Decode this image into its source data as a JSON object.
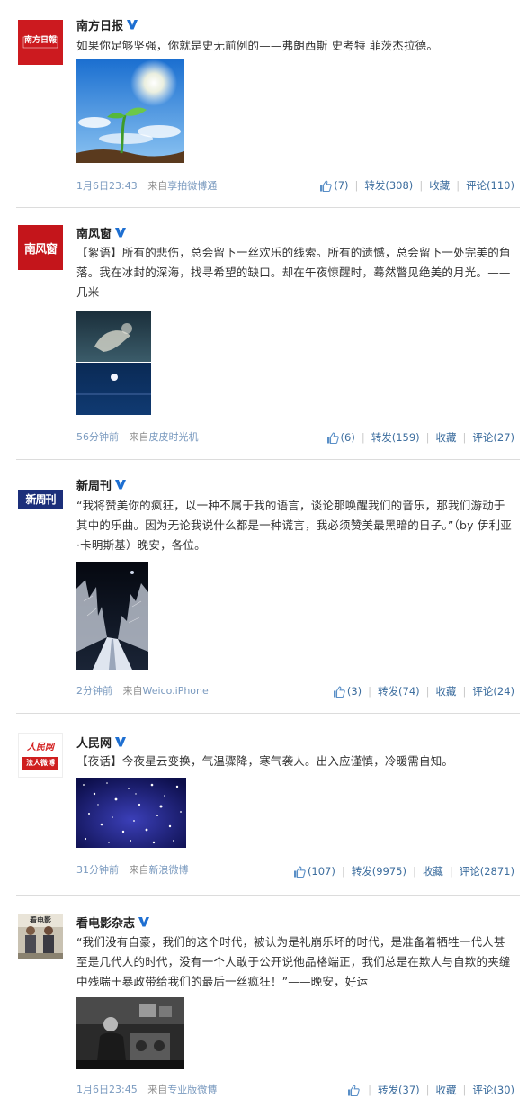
{
  "posts": [
    {
      "author": "南方日报",
      "avatar_text": "南方日報",
      "text": "如果你足够坚强，你就是史无前例的——弗朗西斯 史考特 菲茨杰拉德。",
      "time": "1月6日23:43",
      "source_prefix": "来自",
      "source": "享拍微博通",
      "like": "(7)",
      "forward": "转发(308)",
      "fav": "收藏",
      "comment": "评论(110)"
    },
    {
      "author": "南风窗",
      "avatar_text": "南风窗",
      "text": "【絮语】所有的悲伤，总会留下一丝欢乐的线索。所有的遗憾，总会留下一处完美的角落。我在冰封的深海，找寻希望的缺口。却在午夜惊醒时，蓦然瞥见绝美的月光。——几米",
      "time": "56分钟前",
      "source_prefix": "来自",
      "source": "皮皮时光机",
      "like": "(6)",
      "forward": "转发(159)",
      "fav": "收藏",
      "comment": "评论(27)"
    },
    {
      "author": "新周刊",
      "avatar_text": "新周刊",
      "text": "“我将赞美你的疯狂，以一种不属于我的语言，谈论那唤醒我们的音乐，那我们游动于其中的乐曲。因为无论我说什么都是一种谎言，我必须赞美最黑暗的日子。”（by 伊利亚·卡明斯基）晚安，各位。",
      "time": "2分钟前",
      "source_prefix": "来自",
      "source": "Weico.iPhone",
      "like": "(3)",
      "forward": "转发(74)",
      "fav": "收藏",
      "comment": "评论(24)"
    },
    {
      "author": "人民网",
      "avatar_text_top": "人民网",
      "avatar_text_bottom": "法人微博",
      "text": "【夜话】今夜星云变换，气温骤降，寒气袭人。出入应谨慎，冷暖需自知。",
      "time": "31分钟前",
      "source_prefix": "来自",
      "source": "新浪微博",
      "like": "(107)",
      "forward": "转发(9975)",
      "fav": "收藏",
      "comment": "评论(2871)"
    },
    {
      "author": "看电影杂志",
      "avatar_text": "看电影",
      "text": "“我们没有自豪，我们的这个时代，被认为是礼崩乐坏的时代，是准备着牺牲一代人甚至是几代人的时代，没有一个人敢于公开说他品格端正，我们总是在欺人与自欺的夹缝中残喘于暴政带给我们的最后一丝疯狂！”——晚安，好运",
      "time": "1月6日23:45",
      "source_prefix": "来自",
      "source": "专业版微博",
      "like": "",
      "forward": "转发(37)",
      "fav": "收藏",
      "comment": "评论(30)"
    }
  ],
  "colors": {
    "link": "#3c6d9e",
    "meta": "#8c8c8c",
    "verified": "#1e6fd1"
  }
}
